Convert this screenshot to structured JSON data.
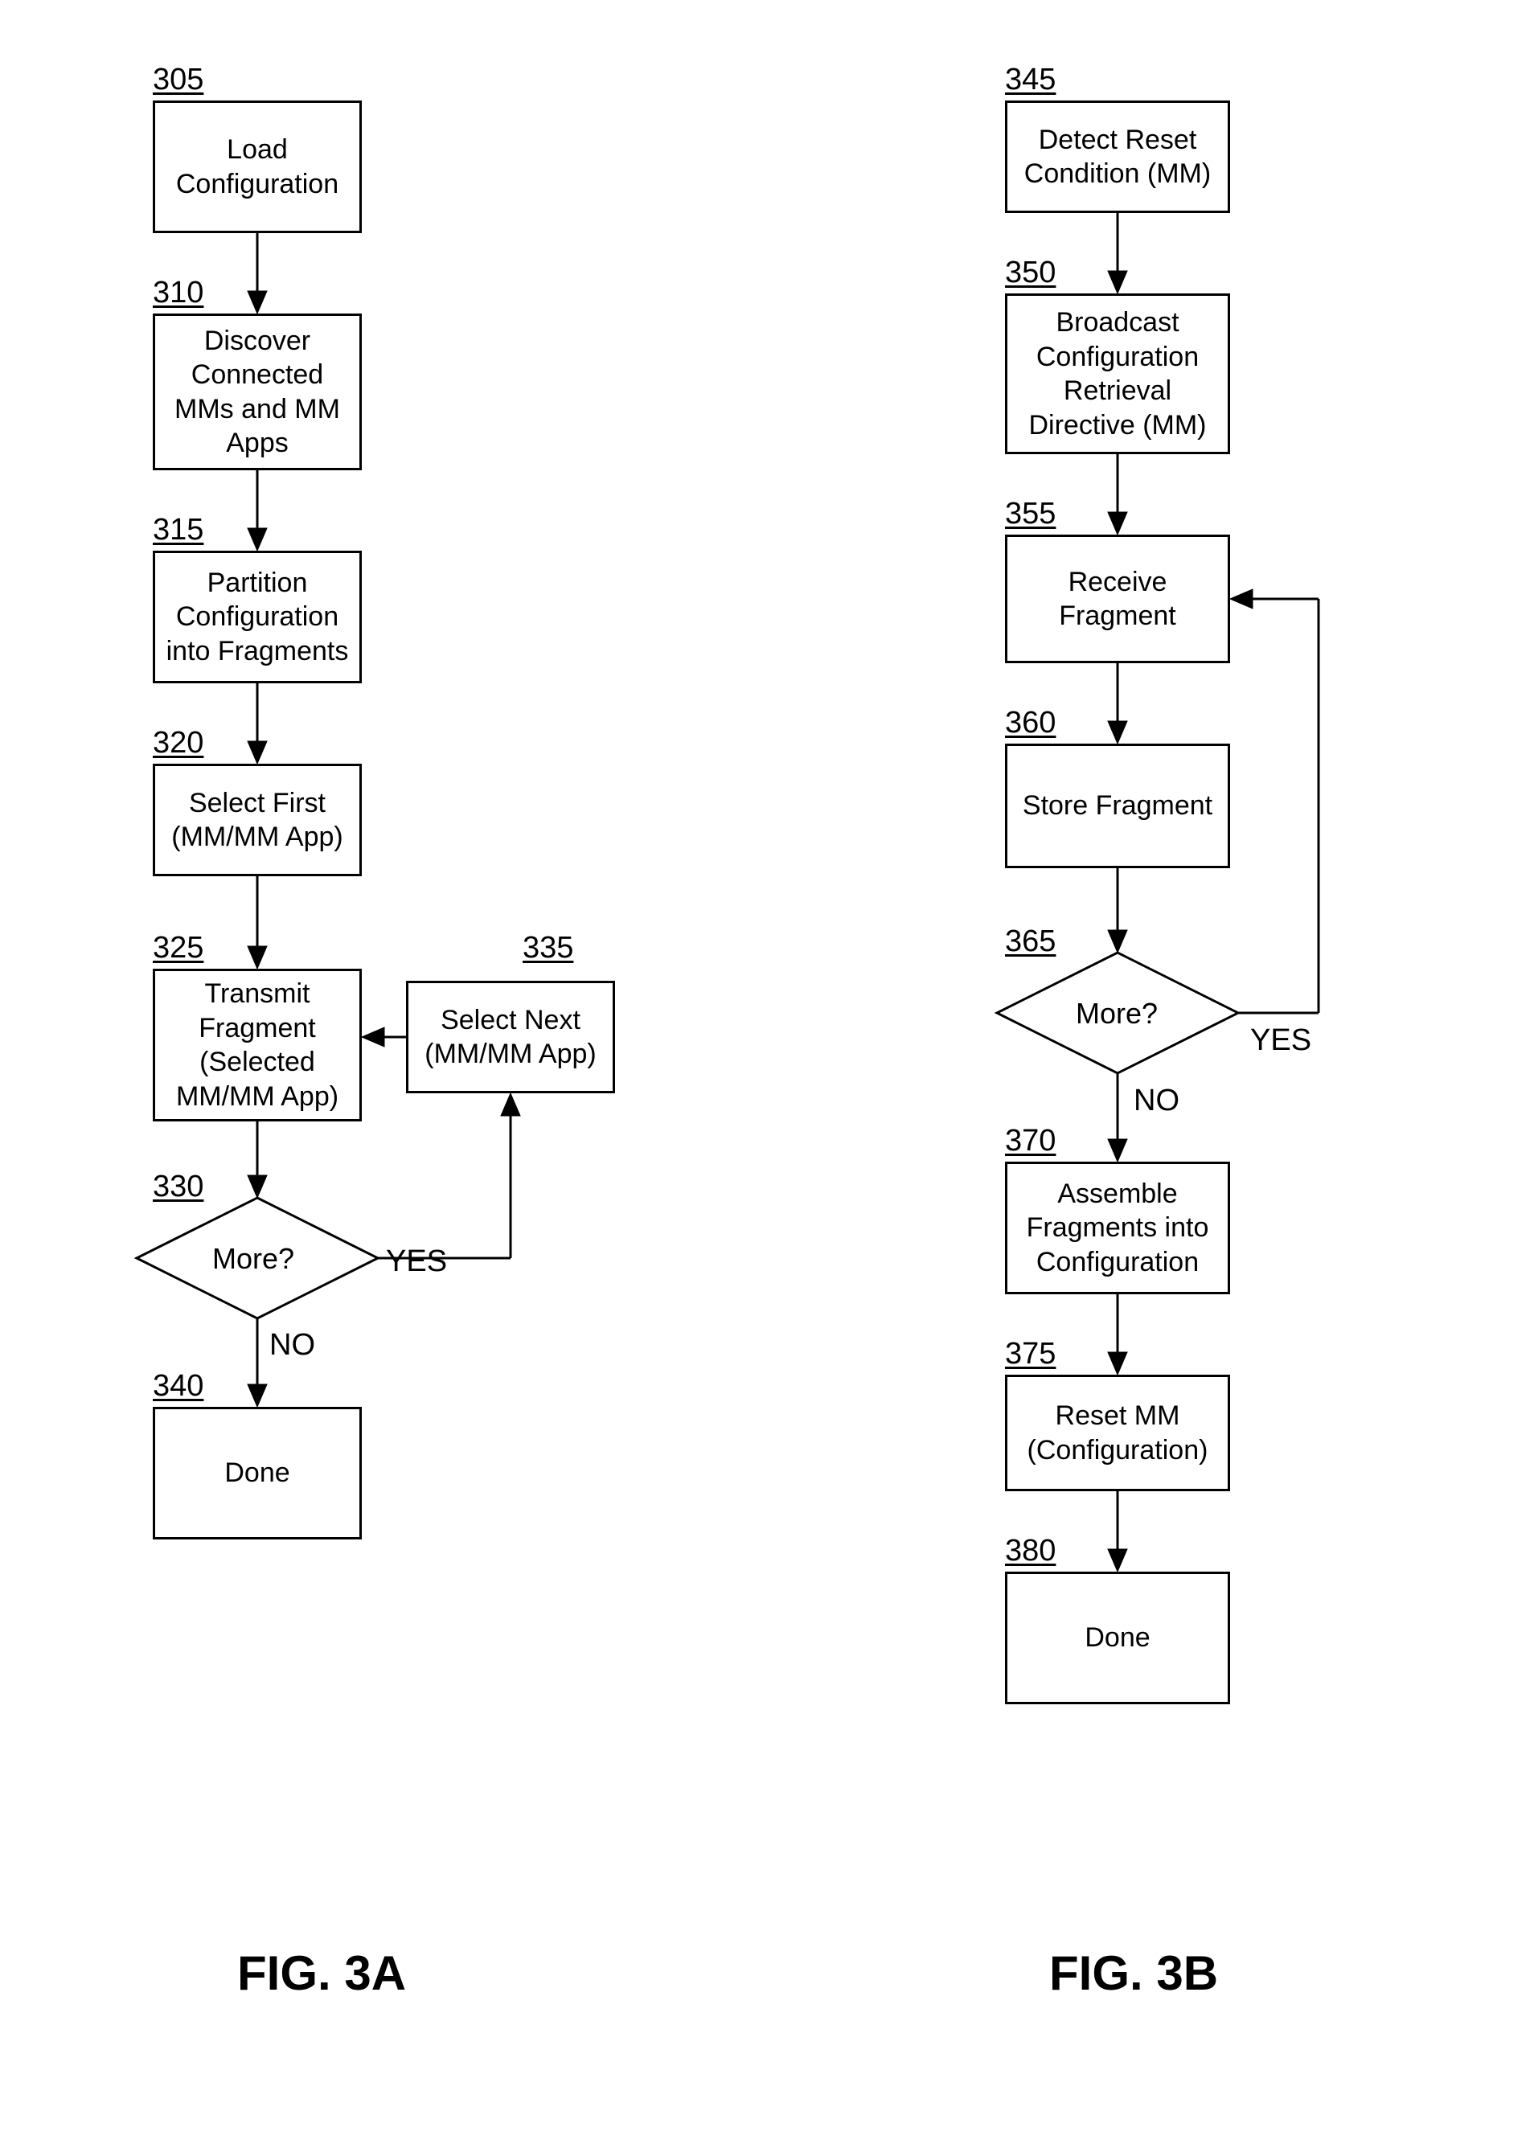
{
  "figA": {
    "title": "FIG. 3A",
    "n305": {
      "num": "305",
      "text": "Load Configuration"
    },
    "n310": {
      "num": "310",
      "text": "Discover Connected MMs and MM Apps"
    },
    "n315": {
      "num": "315",
      "text": "Partition Configuration into Fragments"
    },
    "n320": {
      "num": "320",
      "text": "Select First (MM/MM App)"
    },
    "n325": {
      "num": "325",
      "text": "Transmit Fragment (Selected MM/MM App)"
    },
    "n330": {
      "num": "330",
      "text": "More?",
      "yes": "YES",
      "no": "NO"
    },
    "n335": {
      "num": "335",
      "text": "Select Next (MM/MM App)"
    },
    "n340": {
      "num": "340",
      "text": "Done"
    }
  },
  "figB": {
    "title": "FIG. 3B",
    "n345": {
      "num": "345",
      "text": "Detect Reset Condition (MM)"
    },
    "n350": {
      "num": "350",
      "text": "Broadcast Configuration Retrieval Directive (MM)"
    },
    "n355": {
      "num": "355",
      "text": "Receive Fragment"
    },
    "n360": {
      "num": "360",
      "text": "Store Fragment"
    },
    "n365": {
      "num": "365",
      "text": "More?",
      "yes": "YES",
      "no": "NO"
    },
    "n370": {
      "num": "370",
      "text": "Assemble Fragments into Configuration"
    },
    "n375": {
      "num": "375",
      "text": "Reset MM (Configuration)"
    },
    "n380": {
      "num": "380",
      "text": "Done"
    }
  }
}
